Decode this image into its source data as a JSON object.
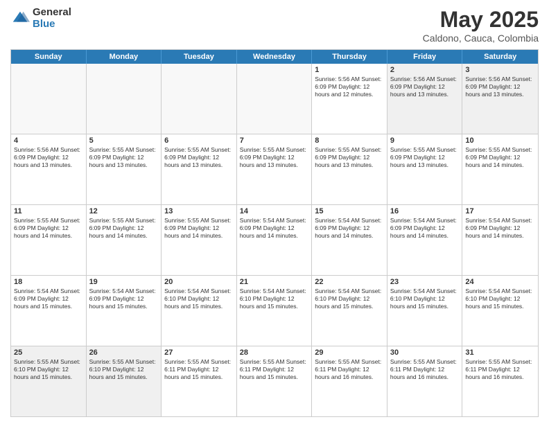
{
  "header": {
    "logo_general": "General",
    "logo_blue": "Blue",
    "month": "May 2025",
    "location": "Caldono, Cauca, Colombia"
  },
  "weekdays": [
    "Sunday",
    "Monday",
    "Tuesday",
    "Wednesday",
    "Thursday",
    "Friday",
    "Saturday"
  ],
  "rows": [
    [
      {
        "day": "",
        "info": "",
        "empty": true
      },
      {
        "day": "",
        "info": "",
        "empty": true
      },
      {
        "day": "",
        "info": "",
        "empty": true
      },
      {
        "day": "",
        "info": "",
        "empty": true
      },
      {
        "day": "1",
        "info": "Sunrise: 5:56 AM\nSunset: 6:09 PM\nDaylight: 12 hours\nand 12 minutes."
      },
      {
        "day": "2",
        "info": "Sunrise: 5:56 AM\nSunset: 6:09 PM\nDaylight: 12 hours\nand 13 minutes."
      },
      {
        "day": "3",
        "info": "Sunrise: 5:56 AM\nSunset: 6:09 PM\nDaylight: 12 hours\nand 13 minutes."
      }
    ],
    [
      {
        "day": "4",
        "info": "Sunrise: 5:56 AM\nSunset: 6:09 PM\nDaylight: 12 hours\nand 13 minutes."
      },
      {
        "day": "5",
        "info": "Sunrise: 5:55 AM\nSunset: 6:09 PM\nDaylight: 12 hours\nand 13 minutes."
      },
      {
        "day": "6",
        "info": "Sunrise: 5:55 AM\nSunset: 6:09 PM\nDaylight: 12 hours\nand 13 minutes."
      },
      {
        "day": "7",
        "info": "Sunrise: 5:55 AM\nSunset: 6:09 PM\nDaylight: 12 hours\nand 13 minutes."
      },
      {
        "day": "8",
        "info": "Sunrise: 5:55 AM\nSunset: 6:09 PM\nDaylight: 12 hours\nand 13 minutes."
      },
      {
        "day": "9",
        "info": "Sunrise: 5:55 AM\nSunset: 6:09 PM\nDaylight: 12 hours\nand 13 minutes."
      },
      {
        "day": "10",
        "info": "Sunrise: 5:55 AM\nSunset: 6:09 PM\nDaylight: 12 hours\nand 14 minutes."
      }
    ],
    [
      {
        "day": "11",
        "info": "Sunrise: 5:55 AM\nSunset: 6:09 PM\nDaylight: 12 hours\nand 14 minutes."
      },
      {
        "day": "12",
        "info": "Sunrise: 5:55 AM\nSunset: 6:09 PM\nDaylight: 12 hours\nand 14 minutes."
      },
      {
        "day": "13",
        "info": "Sunrise: 5:55 AM\nSunset: 6:09 PM\nDaylight: 12 hours\nand 14 minutes."
      },
      {
        "day": "14",
        "info": "Sunrise: 5:54 AM\nSunset: 6:09 PM\nDaylight: 12 hours\nand 14 minutes."
      },
      {
        "day": "15",
        "info": "Sunrise: 5:54 AM\nSunset: 6:09 PM\nDaylight: 12 hours\nand 14 minutes."
      },
      {
        "day": "16",
        "info": "Sunrise: 5:54 AM\nSunset: 6:09 PM\nDaylight: 12 hours\nand 14 minutes."
      },
      {
        "day": "17",
        "info": "Sunrise: 5:54 AM\nSunset: 6:09 PM\nDaylight: 12 hours\nand 14 minutes."
      }
    ],
    [
      {
        "day": "18",
        "info": "Sunrise: 5:54 AM\nSunset: 6:09 PM\nDaylight: 12 hours\nand 15 minutes."
      },
      {
        "day": "19",
        "info": "Sunrise: 5:54 AM\nSunset: 6:09 PM\nDaylight: 12 hours\nand 15 minutes."
      },
      {
        "day": "20",
        "info": "Sunrise: 5:54 AM\nSunset: 6:10 PM\nDaylight: 12 hours\nand 15 minutes."
      },
      {
        "day": "21",
        "info": "Sunrise: 5:54 AM\nSunset: 6:10 PM\nDaylight: 12 hours\nand 15 minutes."
      },
      {
        "day": "22",
        "info": "Sunrise: 5:54 AM\nSunset: 6:10 PM\nDaylight: 12 hours\nand 15 minutes."
      },
      {
        "day": "23",
        "info": "Sunrise: 5:54 AM\nSunset: 6:10 PM\nDaylight: 12 hours\nand 15 minutes."
      },
      {
        "day": "24",
        "info": "Sunrise: 5:54 AM\nSunset: 6:10 PM\nDaylight: 12 hours\nand 15 minutes."
      }
    ],
    [
      {
        "day": "25",
        "info": "Sunrise: 5:55 AM\nSunset: 6:10 PM\nDaylight: 12 hours\nand 15 minutes."
      },
      {
        "day": "26",
        "info": "Sunrise: 5:55 AM\nSunset: 6:10 PM\nDaylight: 12 hours\nand 15 minutes."
      },
      {
        "day": "27",
        "info": "Sunrise: 5:55 AM\nSunset: 6:11 PM\nDaylight: 12 hours\nand 15 minutes."
      },
      {
        "day": "28",
        "info": "Sunrise: 5:55 AM\nSunset: 6:11 PM\nDaylight: 12 hours\nand 15 minutes."
      },
      {
        "day": "29",
        "info": "Sunrise: 5:55 AM\nSunset: 6:11 PM\nDaylight: 12 hours\nand 16 minutes."
      },
      {
        "day": "30",
        "info": "Sunrise: 5:55 AM\nSunset: 6:11 PM\nDaylight: 12 hours\nand 16 minutes."
      },
      {
        "day": "31",
        "info": "Sunrise: 5:55 AM\nSunset: 6:11 PM\nDaylight: 12 hours\nand 16 minutes."
      }
    ]
  ]
}
